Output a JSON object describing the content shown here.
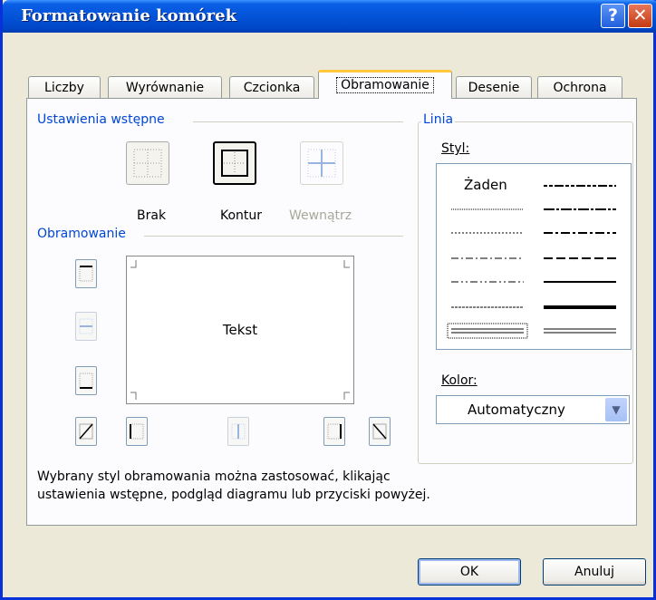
{
  "window": {
    "title": "Formatowanie komórek",
    "help_glyph": "?",
    "close_glyph": "✕"
  },
  "tabs": [
    "Liczby",
    "Wyrównanie",
    "Czcionka",
    "Obramowanie",
    "Desenie",
    "Ochrona"
  ],
  "active_tab": "Obramowanie",
  "presets": {
    "section_label": "Ustawienia wstępne",
    "items": [
      {
        "label": "Brak",
        "enabled": true
      },
      {
        "label": "Kontur",
        "enabled": true
      },
      {
        "label": "Wewnątrz",
        "enabled": false
      }
    ]
  },
  "border": {
    "section_label": "Obramowanie",
    "preview_text": "Tekst"
  },
  "line": {
    "section_label": "Linia",
    "style_label": "Styl:",
    "none_label": "Żaden",
    "color_label": "Kolor:",
    "color_value": "Automatyczny"
  },
  "info_text_1": "Wybrany styl obramowania można zastosować, klikając",
  "info_text_2": "ustawienia wstępne, podgląd diagramu lub przyciski powyżej.",
  "buttons": {
    "ok": "OK",
    "cancel": "Anuluj"
  },
  "colors": {
    "title_bar": "#0a5fe6",
    "dialog_bg": "#ece9d8",
    "section_label": "#0046d5",
    "active_tab_accent": "#ffc83c"
  }
}
